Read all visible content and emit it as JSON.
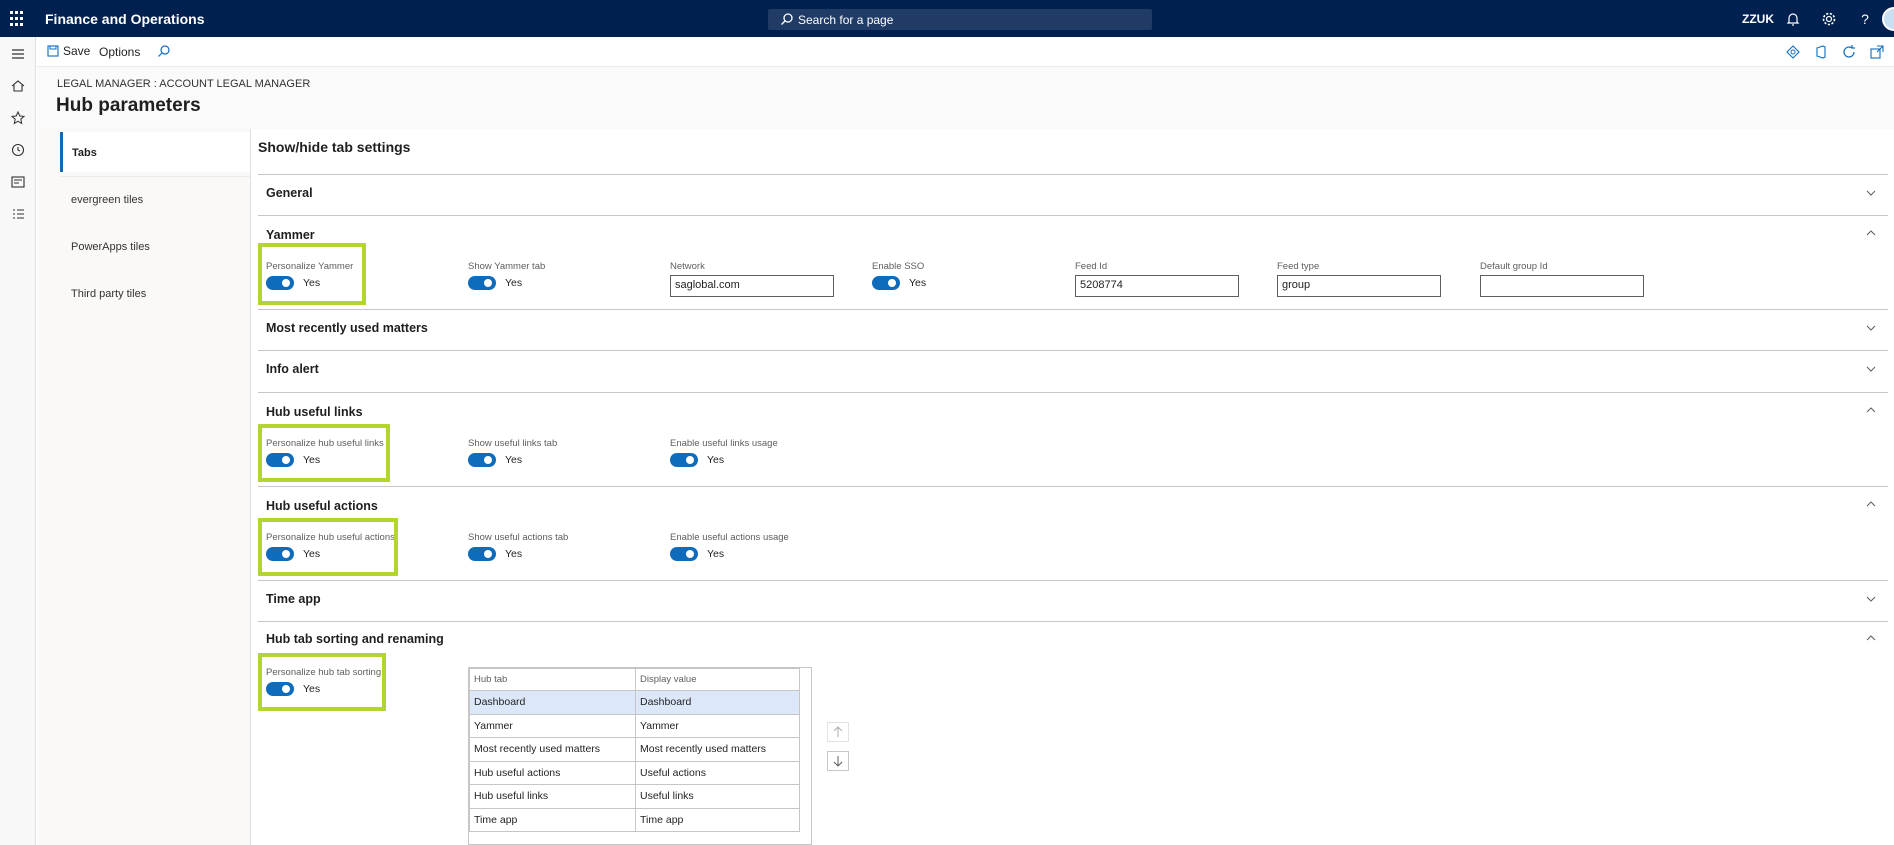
{
  "app": {
    "title": "Finance and Operations",
    "search_placeholder": "Search for a page",
    "user": "ZZUK",
    "help": "?"
  },
  "action_pane": {
    "save": "Save",
    "options": "Options"
  },
  "header": {
    "breadcrumb": "LEGAL MANAGER : ACCOUNT LEGAL MANAGER",
    "title": "Hub parameters"
  },
  "vertical_tabs": [
    "Tabs",
    "evergreen tiles",
    "PowerApps tiles",
    "Third party tiles"
  ],
  "section_title": "Show/hide tab settings",
  "fasttabs": {
    "general": "General",
    "yammer": "Yammer",
    "mru": "Most recently used matters",
    "info": "Info alert",
    "links": "Hub useful links",
    "actions": "Hub useful actions",
    "timeapp": "Time app",
    "sorting": "Hub tab sorting and renaming"
  },
  "yammer": {
    "personalize_label": "Personalize Yammer",
    "personalize_value": "Yes",
    "show_label": "Show Yammer tab",
    "show_value": "Yes",
    "network_label": "Network",
    "network_value": "saglobal.com",
    "sso_label": "Enable SSO",
    "sso_value": "Yes",
    "feedid_label": "Feed Id",
    "feedid_value": "5208774",
    "feedtype_label": "Feed type",
    "feedtype_value": "group",
    "group_label": "Default group Id",
    "group_value": ""
  },
  "links": {
    "personalize_label": "Personalize hub useful links",
    "personalize_value": "Yes",
    "show_label": "Show useful links tab",
    "show_value": "Yes",
    "usage_label": "Enable useful links usage",
    "usage_value": "Yes"
  },
  "actions": {
    "personalize_label": "Personalize hub useful actions",
    "personalize_value": "Yes",
    "show_label": "Show useful actions tab",
    "show_value": "Yes",
    "usage_label": "Enable useful actions usage",
    "usage_value": "Yes"
  },
  "sorting": {
    "personalize_label": "Personalize hub tab sorting",
    "personalize_value": "Yes",
    "grid_headers": [
      "Hub tab",
      "Display value"
    ],
    "grid_rows": [
      [
        "Dashboard",
        "Dashboard"
      ],
      [
        "Yammer",
        "Yammer"
      ],
      [
        "Most recently used matters",
        "Most recently used matters"
      ],
      [
        "Hub useful actions",
        "Useful actions"
      ],
      [
        "Hub useful links",
        "Useful links"
      ],
      [
        "Time app",
        "Time app"
      ]
    ]
  },
  "colors": {
    "topbar": "#002050",
    "accent": "#0f6cbd",
    "highlight": "#b2d62e"
  }
}
